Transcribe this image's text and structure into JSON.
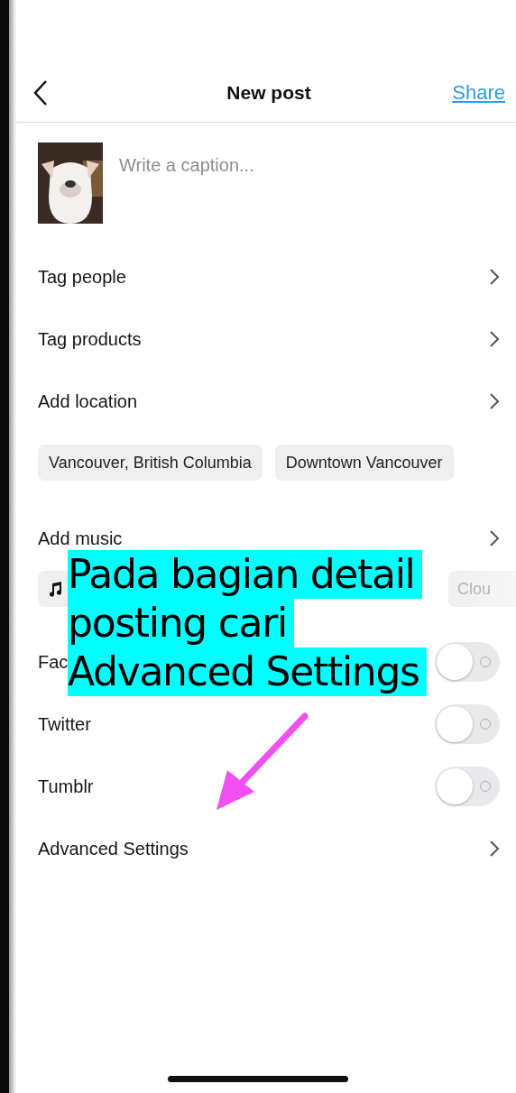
{
  "header": {
    "title": "New post",
    "action": "Share"
  },
  "caption": {
    "placeholder": "Write a caption..."
  },
  "rows": [
    {
      "kind": "link",
      "label": "Tag people"
    },
    {
      "kind": "link",
      "label": "Tag products"
    },
    {
      "kind": "link",
      "label": "Add location"
    },
    {
      "kind": "chips",
      "chips": [
        {
          "label": "Vancouver, British Columbia"
        },
        {
          "label": "Downtown Vancouver"
        }
      ]
    },
    {
      "kind": "link",
      "label": "Add music"
    },
    {
      "kind": "music",
      "chips": [
        {
          "kind": "icon"
        },
        {
          "kind": "text",
          "label": "Clou"
        }
      ]
    },
    {
      "kind": "toggle",
      "label": "Fac",
      "on": false
    },
    {
      "kind": "toggle",
      "label": "Twitter",
      "on": false
    },
    {
      "kind": "toggle",
      "label": "Tumblr",
      "on": false
    },
    {
      "kind": "link",
      "label": "Advanced Settings"
    }
  ],
  "overlay": {
    "lines": [
      "Pada bagian detail",
      "posting cari",
      "Advanced Settings"
    ]
  }
}
